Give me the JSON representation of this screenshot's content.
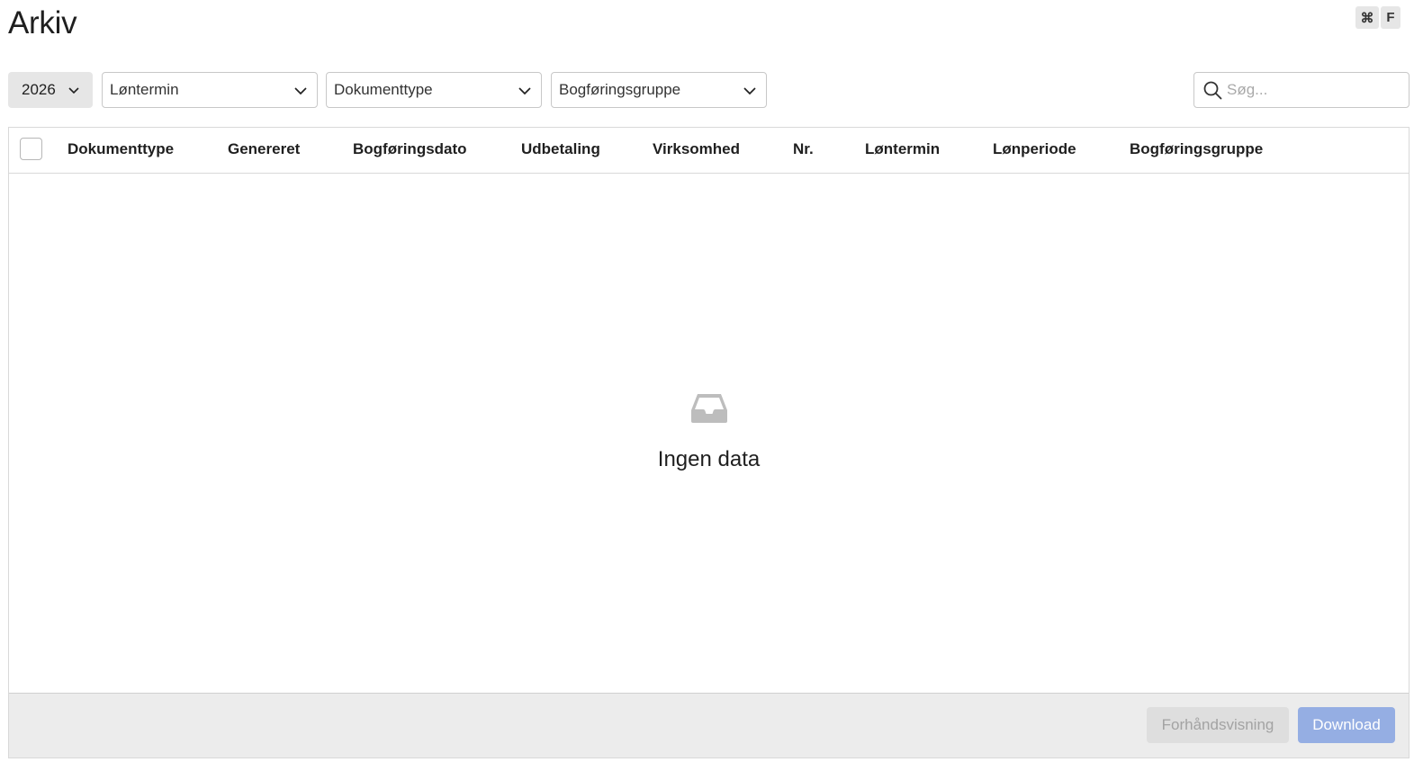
{
  "page": {
    "title": "Arkiv"
  },
  "toolbar": {
    "year": "2026",
    "filters": [
      {
        "label": "Løntermin"
      },
      {
        "label": "Dokumenttype"
      },
      {
        "label": "Bogføringsgruppe"
      }
    ],
    "search": {
      "placeholder": "Søg...",
      "shortcut_modifier": "⌘",
      "shortcut_key": "F"
    }
  },
  "table": {
    "columns": [
      "Dokumenttype",
      "Genereret",
      "Bogføringsdato",
      "Udbetaling",
      "Virksomhed",
      "Nr.",
      "Løntermin",
      "Lønperiode",
      "Bogføringsgruppe"
    ],
    "rows": [],
    "empty_text": "Ingen data",
    "empty_icon": "inbox-icon"
  },
  "footer": {
    "preview_label": "Forhåndsvisning",
    "download_label": "Download"
  },
  "colors": {
    "download_button": "#95aee3",
    "footer_background": "#ececec",
    "year_background": "#e6e6e6"
  }
}
